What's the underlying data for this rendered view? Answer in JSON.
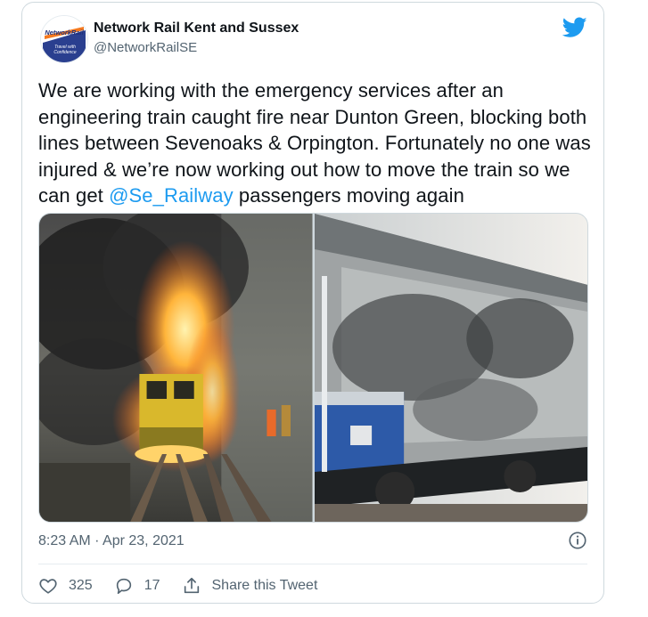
{
  "tweet": {
    "author": {
      "display_name": "Network Rail Kent and Sussex",
      "handle": "@NetworkRailSE",
      "avatar_brand": "NetworkRail",
      "avatar_tagline_1": "Travel with",
      "avatar_tagline_2": "Confidence"
    },
    "text_before_mention": "We are working with the emergency services after an engineering train caught fire near Dunton Green, blocking both lines between Sevenoaks & Orpington. Fortunately no one was injured & we’re now working out how to move the train so we can get ",
    "mention": "@Se_Railway",
    "text_after_mention": " passengers moving again",
    "timestamp": "8:23 AM · Apr 23, 2021",
    "likes": "325",
    "replies": "17",
    "share_label": "Share this Tweet"
  },
  "colors": {
    "twitter_blue": "#1d9bf0",
    "text_primary": "#0f1419",
    "text_secondary": "#536471",
    "border": "#cfd9de"
  },
  "icons": {
    "brand": "twitter-bird-icon",
    "info": "info-icon",
    "like": "heart-icon",
    "reply": "reply-bubble-icon",
    "share": "share-icon"
  }
}
